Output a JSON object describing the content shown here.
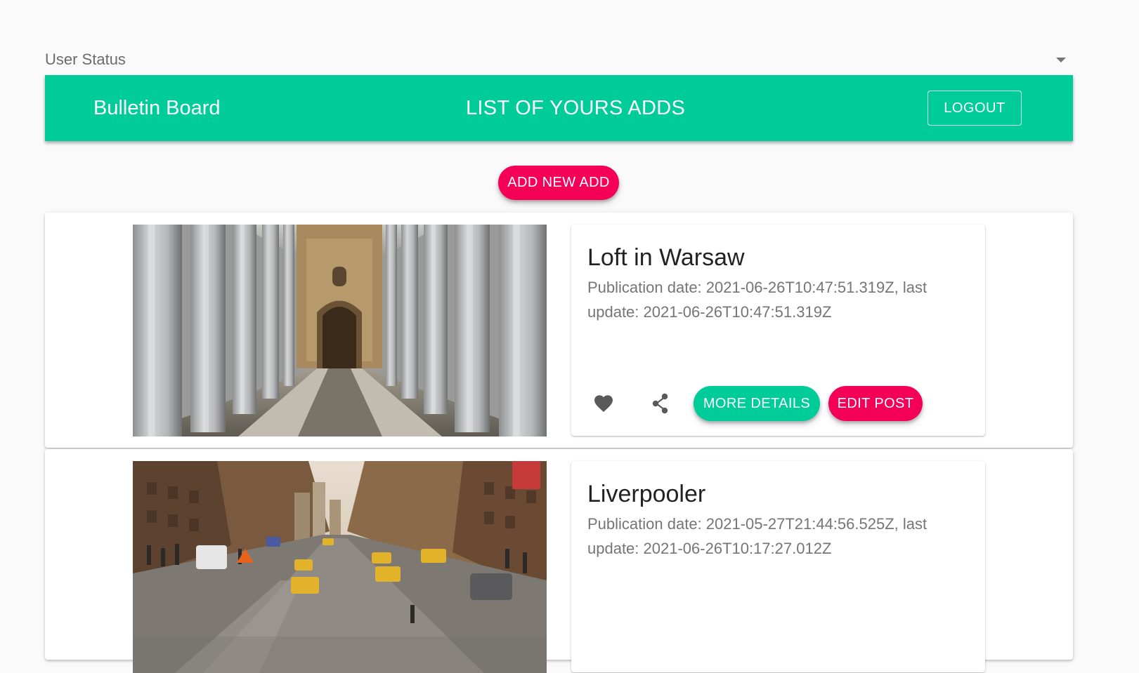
{
  "user_status": {
    "label": "User Status"
  },
  "appbar": {
    "brand": "Bulletin Board",
    "heading": "LIST OF YOURS ADDS",
    "logout_label": "LOGOUT",
    "color": "#00cc99"
  },
  "add_new_label": "ADD NEW ADD",
  "accent_color": "#f50057",
  "posts": [
    {
      "title": "Loft in Warsaw",
      "dates": "Publication date: 2021-06-26T10:47:51.319Z, last update: 2021-06-26T10:47:51.319Z",
      "image": "colonnade-photo",
      "more_details_label": "MORE DETAILS",
      "edit_label": "EDIT POST"
    },
    {
      "title": "Liverpooler",
      "dates": "Publication date: 2021-05-27T21:44:56.525Z, last update: 2021-06-26T10:17:27.012Z",
      "image": "city-street-photo"
    }
  ],
  "icons": {
    "favorite": "heart-icon",
    "share": "share-icon",
    "dropdown": "caret-down-icon"
  }
}
